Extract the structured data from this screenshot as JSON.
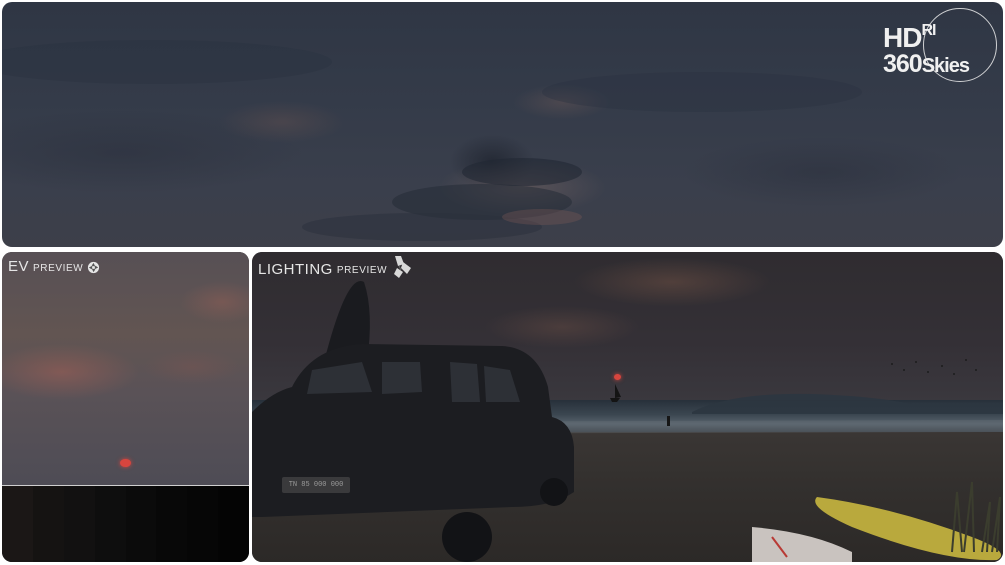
{
  "logo": {
    "line1_main": "HD",
    "line1_super": "RI",
    "line2_main": "360",
    "line2_tail": "Skies"
  },
  "ev_preview": {
    "label_main": "EV",
    "label_sub": "PREVIEW",
    "icon": "aperture-icon",
    "swatches": [
      "#1b1716",
      "#151312",
      "#121111",
      "#0e0e0e",
      "#0b0b0b",
      "#080808",
      "#060606",
      "#040404"
    ]
  },
  "lighting_preview": {
    "label_main": "LIGHTING",
    "label_sub": "PREVIEW",
    "icon": "spotlight-icon",
    "car_plate": "TN 85 000 000"
  },
  "colors": {
    "sun_marker": "#d8453e",
    "label_text": "#e6e6e6"
  }
}
